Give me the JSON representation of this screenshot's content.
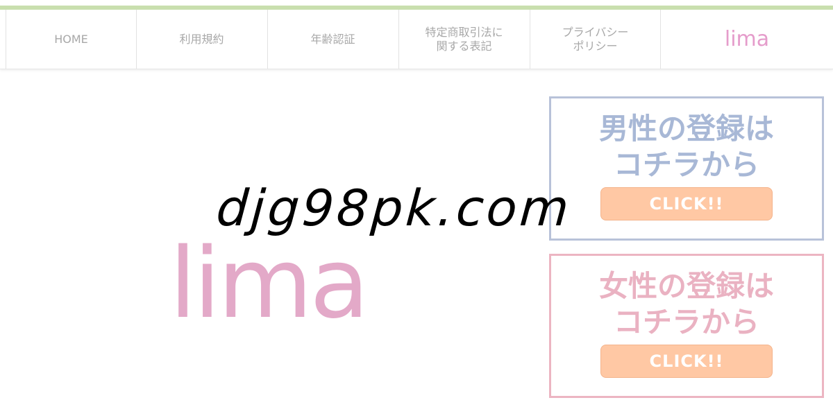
{
  "nav": {
    "items": [
      {
        "label": "HOME"
      },
      {
        "label": "利用規約"
      },
      {
        "label": "年齢認証"
      },
      {
        "label": "特定商取引法に\n関する表記"
      },
      {
        "label": "プライバシー\nポリシー"
      }
    ],
    "logo": "lima"
  },
  "watermark": "djg98pk.com",
  "hero": {
    "logo": "lima"
  },
  "register": {
    "male": {
      "title": "男性の登録は\nコチラから",
      "button": "CLICK!!"
    },
    "female": {
      "title": "女性の登録は\nコチラから",
      "button": "CLICK!!"
    }
  },
  "colors": {
    "top_bar": "#c9dfae",
    "brand_pink": "#e59ccb",
    "male_accent": "#a8b8d6",
    "female_accent": "#eab2c2",
    "button": "#ffc8a4"
  }
}
